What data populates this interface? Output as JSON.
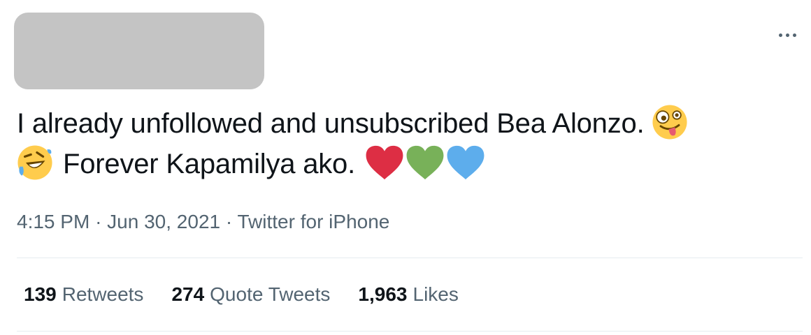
{
  "tweet": {
    "text_line1": "I already unfollowed and unsubscribed Bea Alonzo.",
    "text_line2": "Forever Kapamilya ako.",
    "emojis": [
      "zany-face-icon",
      "rolling-on-floor-laughing-icon",
      "red-heart-icon",
      "green-heart-icon",
      "blue-heart-icon"
    ]
  },
  "meta": {
    "time": "4:15 PM",
    "separator": "·",
    "date": "Jun 30, 2021",
    "source": "Twitter for iPhone"
  },
  "stats": {
    "retweets_count": "139",
    "retweets_label": "Retweets",
    "quotes_count": "274",
    "quotes_label": "Quote Tweets",
    "likes_count": "1,963",
    "likes_label": "Likes"
  },
  "colors": {
    "text": "#0f1419",
    "secondary": "#536471",
    "redaction": "#c4c4c4",
    "divider": "#e6ecf0",
    "heart_red": "#dd2e44",
    "heart_green": "#78b159",
    "heart_blue": "#5dadec"
  }
}
